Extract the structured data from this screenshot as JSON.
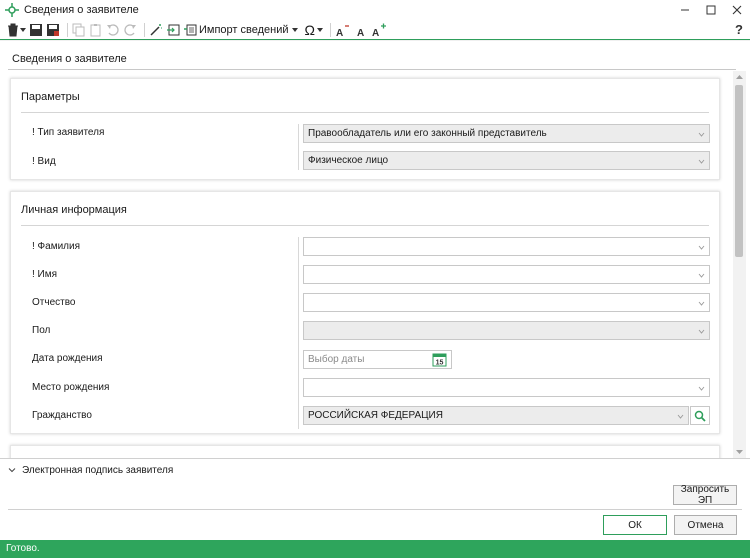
{
  "window": {
    "title": "Сведения о заявителе",
    "help_label": "?"
  },
  "toolbar": {
    "import_label": "Импорт сведений",
    "omega_label": "Ω"
  },
  "page": {
    "title": "Сведения о заявителе"
  },
  "params": {
    "title": "Параметры",
    "type_label": "! Тип заявителя",
    "type_value": "Правообладатель или его законный представитель",
    "kind_label": "! Вид",
    "kind_value": "Физическое лицо"
  },
  "personal": {
    "title": "Личная информация",
    "surname_label": "! Фамилия",
    "surname_value": "",
    "name_label": "! Имя",
    "name_value": "",
    "patronymic_label": "Отчество",
    "patronymic_value": "",
    "sex_label": "Пол",
    "sex_value": "",
    "birthdate_label": "Дата рождения",
    "birthdate_placeholder": "Выбор даты",
    "calendar_day": "15",
    "birthplace_label": "Место рождения",
    "birthplace_value": "",
    "citizenship_label": "Гражданство",
    "citizenship_value": "РОССИЙСКАЯ ФЕДЕРАЦИЯ"
  },
  "expander": {
    "label": "Электронная подпись заявителя"
  },
  "buttons": {
    "request_ep": "Запросить ЭП",
    "ok": "ОК",
    "cancel": "Отмена"
  },
  "status": {
    "text": "Готово."
  },
  "colors": {
    "accent": "#2ea55c"
  }
}
